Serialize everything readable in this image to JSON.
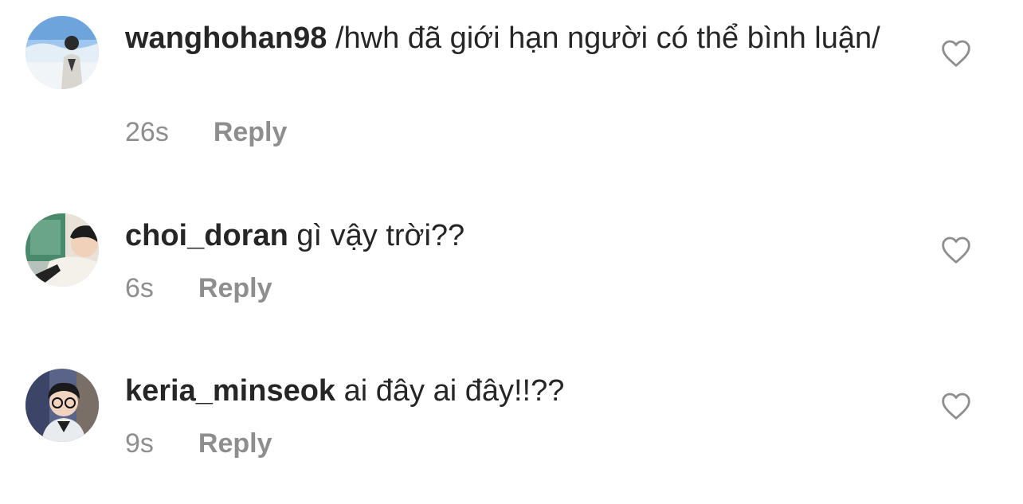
{
  "colors": {
    "text": "#262626",
    "secondary": "#8e8e8e",
    "background": "#ffffff"
  },
  "comments": [
    {
      "username": "wanghohan98",
      "text": "/hwh đã giới hạn người có thể bình luận/",
      "time": "26s",
      "reply_label": "Reply",
      "like_icon": "heart-outline-icon"
    },
    {
      "username": "choi_doran",
      "text": "gì vậy trời??",
      "time": "6s",
      "reply_label": "Reply",
      "like_icon": "heart-outline-icon"
    },
    {
      "username": "keria_minseok",
      "text": "ai đây ai đây!!??",
      "time": "9s",
      "reply_label": "Reply",
      "like_icon": "heart-outline-icon"
    }
  ]
}
